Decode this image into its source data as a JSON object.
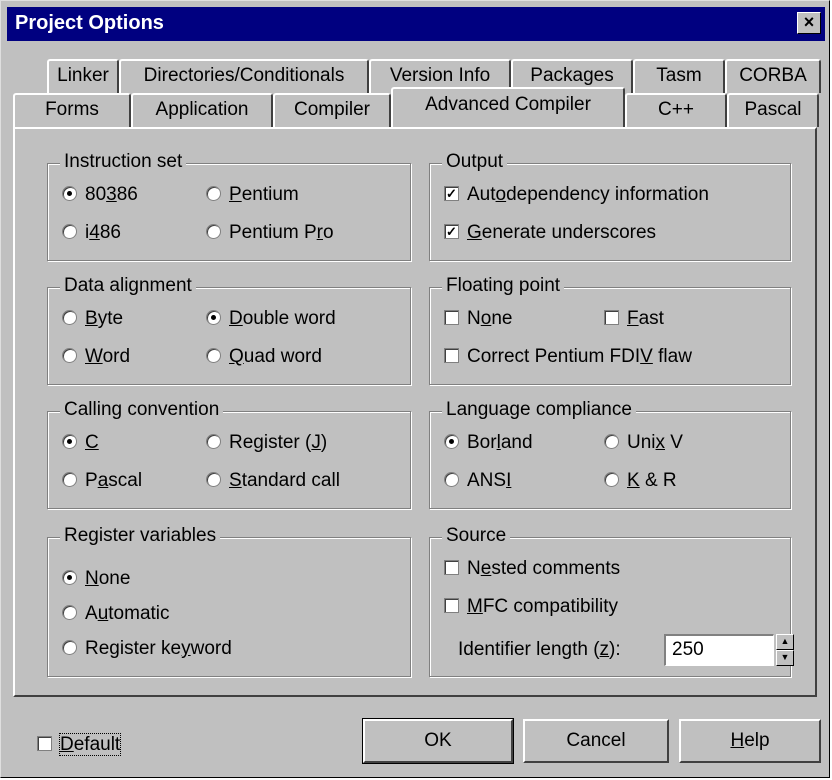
{
  "title": "Project Options",
  "close_icon": "×",
  "tabs_back": [
    "Linker",
    "Directories/Conditionals",
    "Version Info",
    "Packages",
    "Tasm",
    "CORBA"
  ],
  "tabs_front": [
    "Forms",
    "Application",
    "Compiler",
    "Advanced Compiler",
    "C++",
    "Pascal"
  ],
  "instruction_set": {
    "legend": "Instruction set",
    "o80386": {
      "a": "80",
      "k": "3",
      "b": "86"
    },
    "pentium": {
      "a": "",
      "k": "P",
      "b": "entium"
    },
    "i486": {
      "a": "i",
      "k": "4",
      "b": "86"
    },
    "pentium_pro": {
      "a": "Pentium P",
      "k": "r",
      "b": "o"
    }
  },
  "output": {
    "legend": "Output",
    "autodep": {
      "a": "Aut",
      "k": "o",
      "b": "dependency information"
    },
    "underscores": {
      "a": "",
      "k": "G",
      "b": "enerate underscores"
    }
  },
  "data_alignment": {
    "legend": "Data alignment",
    "byte": {
      "a": "",
      "k": "B",
      "b": "yte"
    },
    "double_word": {
      "a": "",
      "k": "D",
      "b": "ouble word"
    },
    "word": {
      "a": "",
      "k": "W",
      "b": "ord"
    },
    "quad_word": {
      "a": "",
      "k": "Q",
      "b": "uad word"
    }
  },
  "floating_point": {
    "legend": "Floating point",
    "none": {
      "a": "N",
      "k": "o",
      "b": "ne"
    },
    "fast": {
      "a": "",
      "k": "F",
      "b": "ast"
    },
    "fdiv": {
      "a": "Correct Pentium FDI",
      "k": "V",
      "b": " flaw"
    }
  },
  "calling_convention": {
    "legend": "Calling convention",
    "c": {
      "a": "",
      "k": "C",
      "b": ""
    },
    "register": {
      "a": "Register (",
      "k": "J",
      "b": ")"
    },
    "pascal": {
      "a": "P",
      "k": "a",
      "b": "scal"
    },
    "standard": {
      "a": "",
      "k": "S",
      "b": "tandard call"
    }
  },
  "language_compliance": {
    "legend": "Language compliance",
    "borland": {
      "a": "Bor",
      "k": "l",
      "b": "and"
    },
    "unixv": {
      "a": "Uni",
      "k": "x",
      "b": " V"
    },
    "ansi": {
      "a": "ANS",
      "k": "I",
      "b": ""
    },
    "kr": {
      "a": "",
      "k": "K",
      "b": " & R"
    }
  },
  "register_variables": {
    "legend": "Register variables",
    "none": {
      "a": "",
      "k": "N",
      "b": "one"
    },
    "automatic": {
      "a": "A",
      "k": "u",
      "b": "tomatic"
    },
    "keyword": {
      "a": "Register ke",
      "k": "y",
      "b": "word"
    }
  },
  "source": {
    "legend": "Source",
    "nested": {
      "a": "N",
      "k": "e",
      "b": "sted comments"
    },
    "mfc": {
      "a": "",
      "k": "M",
      "b": "FC compatibility"
    },
    "ident": {
      "a": "Identifier length (",
      "k": "z",
      "b": "):"
    },
    "ident_value": "250"
  },
  "buttons": {
    "default": {
      "a": "",
      "k": "D",
      "b": "efault"
    },
    "ok": "OK",
    "cancel": "Cancel",
    "help": {
      "a": "",
      "k": "H",
      "b": "elp"
    }
  }
}
